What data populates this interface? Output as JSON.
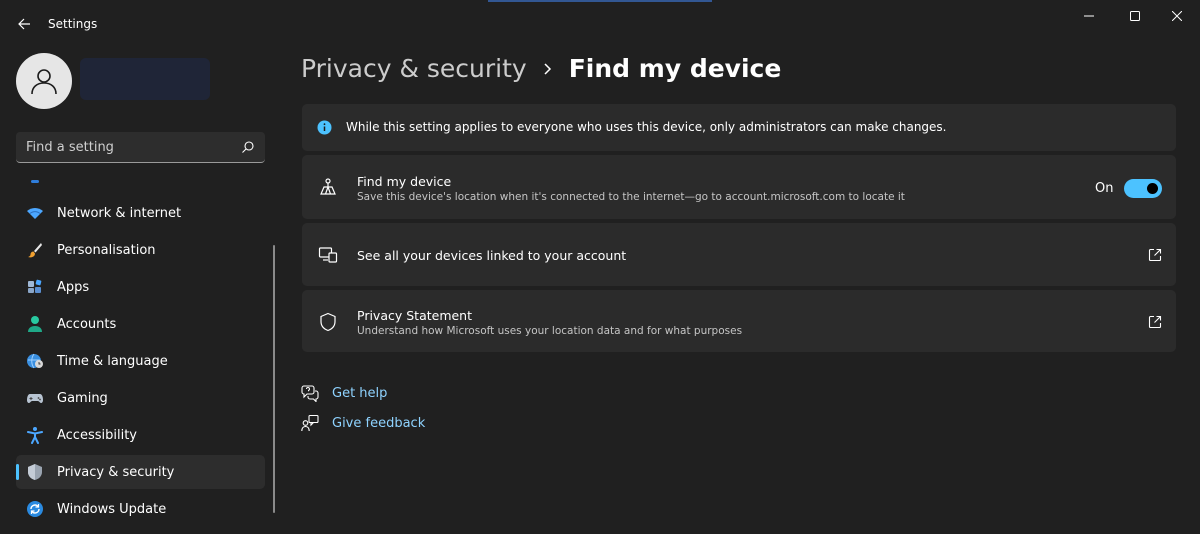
{
  "window": {
    "title": "Settings",
    "controls": [
      "minimize",
      "maximize",
      "close"
    ]
  },
  "colors": {
    "accent": "#4cc2ff",
    "background": "#202020",
    "card": "#2b2b2b",
    "link": "#8fd3ff"
  },
  "search": {
    "placeholder": "Find a setting"
  },
  "sidebar": {
    "items": [
      {
        "label": "Network & internet",
        "icon": "wifi-icon",
        "selected": false
      },
      {
        "label": "Personalisation",
        "icon": "brush-icon",
        "selected": false
      },
      {
        "label": "Apps",
        "icon": "apps-icon",
        "selected": false
      },
      {
        "label": "Accounts",
        "icon": "person-icon",
        "selected": false
      },
      {
        "label": "Time & language",
        "icon": "globe-clock-icon",
        "selected": false
      },
      {
        "label": "Gaming",
        "icon": "gamepad-icon",
        "selected": false
      },
      {
        "label": "Accessibility",
        "icon": "accessibility-icon",
        "selected": false
      },
      {
        "label": "Privacy & security",
        "icon": "shield-icon",
        "selected": true
      },
      {
        "label": "Windows Update",
        "icon": "update-icon",
        "selected": false
      }
    ]
  },
  "breadcrumb": {
    "parent": "Privacy & security",
    "current": "Find my device"
  },
  "info_banner": {
    "text": "While this setting applies to everyone who uses this device, only administrators can make changes.",
    "icon": "info-icon"
  },
  "settings": {
    "find_device": {
      "title": "Find my device",
      "description": "Save this device's location when it's connected to the internet—go to account.microsoft.com to locate it",
      "toggle_label": "On",
      "toggle_on": true,
      "icon": "find-device-icon"
    },
    "linked_devices": {
      "title": "See all your devices linked to your account",
      "icon": "devices-icon"
    },
    "privacy_statement": {
      "title": "Privacy Statement",
      "description": "Understand how Microsoft uses your location data and for what purposes",
      "icon": "shield-outline-icon"
    }
  },
  "help": {
    "get_help": "Get help",
    "give_feedback": "Give feedback"
  }
}
